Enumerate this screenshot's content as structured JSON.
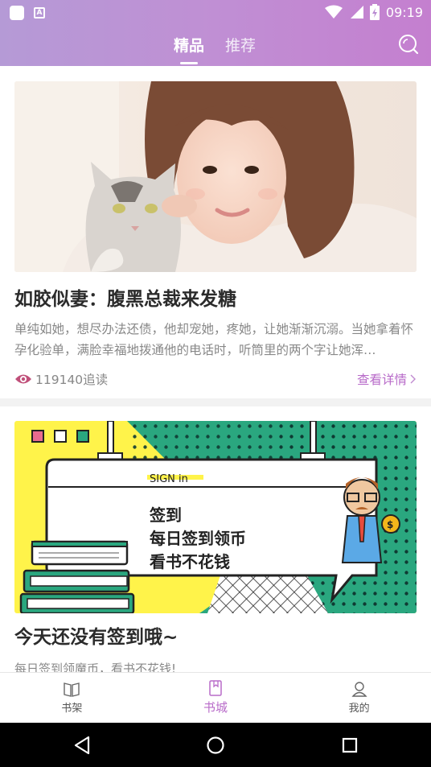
{
  "status_bar": {
    "time": "09:19",
    "icons": [
      "app-icon",
      "a-icon",
      "wifi-icon",
      "signal-icon",
      "battery-icon"
    ]
  },
  "header": {
    "tabs": [
      {
        "label": "精品",
        "active": true
      },
      {
        "label": "推荐",
        "active": false
      }
    ],
    "search_icon": "search-icon"
  },
  "feed": {
    "items": [
      {
        "title": "如胶似妻：腹黑总裁来发糖",
        "description": "单纯如她，想尽办法还债，他却宠她，疼她，让她渐渐沉溺。当她拿着怀孕化验单，满脸幸福地拨通他的电话时，听筒里的两个字让她浑…",
        "views": "119140追读",
        "detail_label": "查看详情"
      },
      {
        "title": "今天还没有签到哦~",
        "description": "每日签到领魔币，看书不花钱!",
        "banner": {
          "tag": "SIGN in",
          "lines": [
            "签到",
            "每日签到领币",
            "看书不花钱"
          ]
        }
      }
    ]
  },
  "bottom_nav": {
    "items": [
      {
        "label": "书架",
        "icon": "bookshelf-icon",
        "active": false
      },
      {
        "label": "书城",
        "icon": "bookstore-icon",
        "active": true
      },
      {
        "label": "我的",
        "icon": "profile-icon",
        "active": false
      }
    ]
  },
  "colors": {
    "accent": "#b86bc9",
    "header_gradient_start": "#b59ad6",
    "header_gradient_end": "#c47fcf"
  }
}
